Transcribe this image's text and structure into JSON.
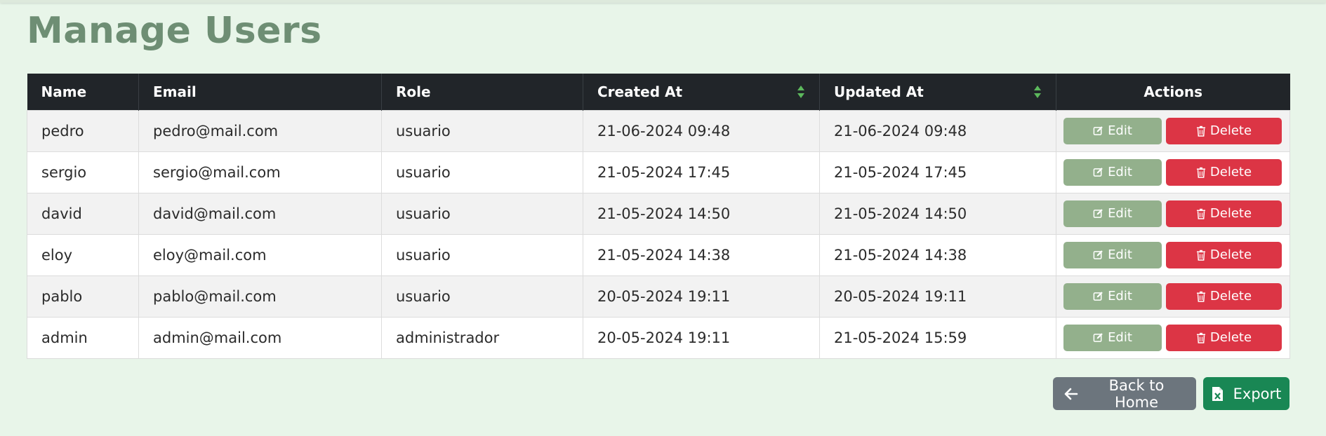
{
  "page": {
    "title": "Manage Users"
  },
  "table": {
    "headers": {
      "name": "Name",
      "email": "Email",
      "role": "Role",
      "created": "Created At",
      "updated": "Updated At",
      "actions": "Actions"
    },
    "rows": [
      {
        "name": "pedro",
        "email": "pedro@mail.com",
        "role": "usuario",
        "created": "21-06-2024 09:48",
        "updated": "21-06-2024 09:48"
      },
      {
        "name": "sergio",
        "email": "sergio@mail.com",
        "role": "usuario",
        "created": "21-05-2024 17:45",
        "updated": "21-05-2024 17:45"
      },
      {
        "name": "david",
        "email": "david@mail.com",
        "role": "usuario",
        "created": "21-05-2024 14:50",
        "updated": "21-05-2024 14:50"
      },
      {
        "name": "eloy",
        "email": "eloy@mail.com",
        "role": "usuario",
        "created": "21-05-2024 14:38",
        "updated": "21-05-2024 14:38"
      },
      {
        "name": "pablo",
        "email": "pablo@mail.com",
        "role": "usuario",
        "created": "20-05-2024 19:11",
        "updated": "20-05-2024 19:11"
      },
      {
        "name": "admin",
        "email": "admin@mail.com",
        "role": "administrador",
        "created": "20-05-2024 19:11",
        "updated": "21-05-2024 15:59"
      }
    ],
    "edit_label": "Edit",
    "delete_label": "Delete"
  },
  "footer": {
    "back_label": "Back to Home",
    "export_label": "Export"
  },
  "colors": {
    "background": "#e8f5e9",
    "title": "#6e8e74",
    "header_bg": "#212529",
    "edit": "#93b08c",
    "delete": "#dc3545",
    "back": "#6c757d",
    "export": "#198754",
    "sort_arrows": "#5cb85c"
  },
  "icons": {
    "edit": "edit-icon",
    "delete": "trash-icon",
    "back": "arrow-left-icon",
    "export": "excel-file-icon",
    "sort": "sort-icon"
  }
}
